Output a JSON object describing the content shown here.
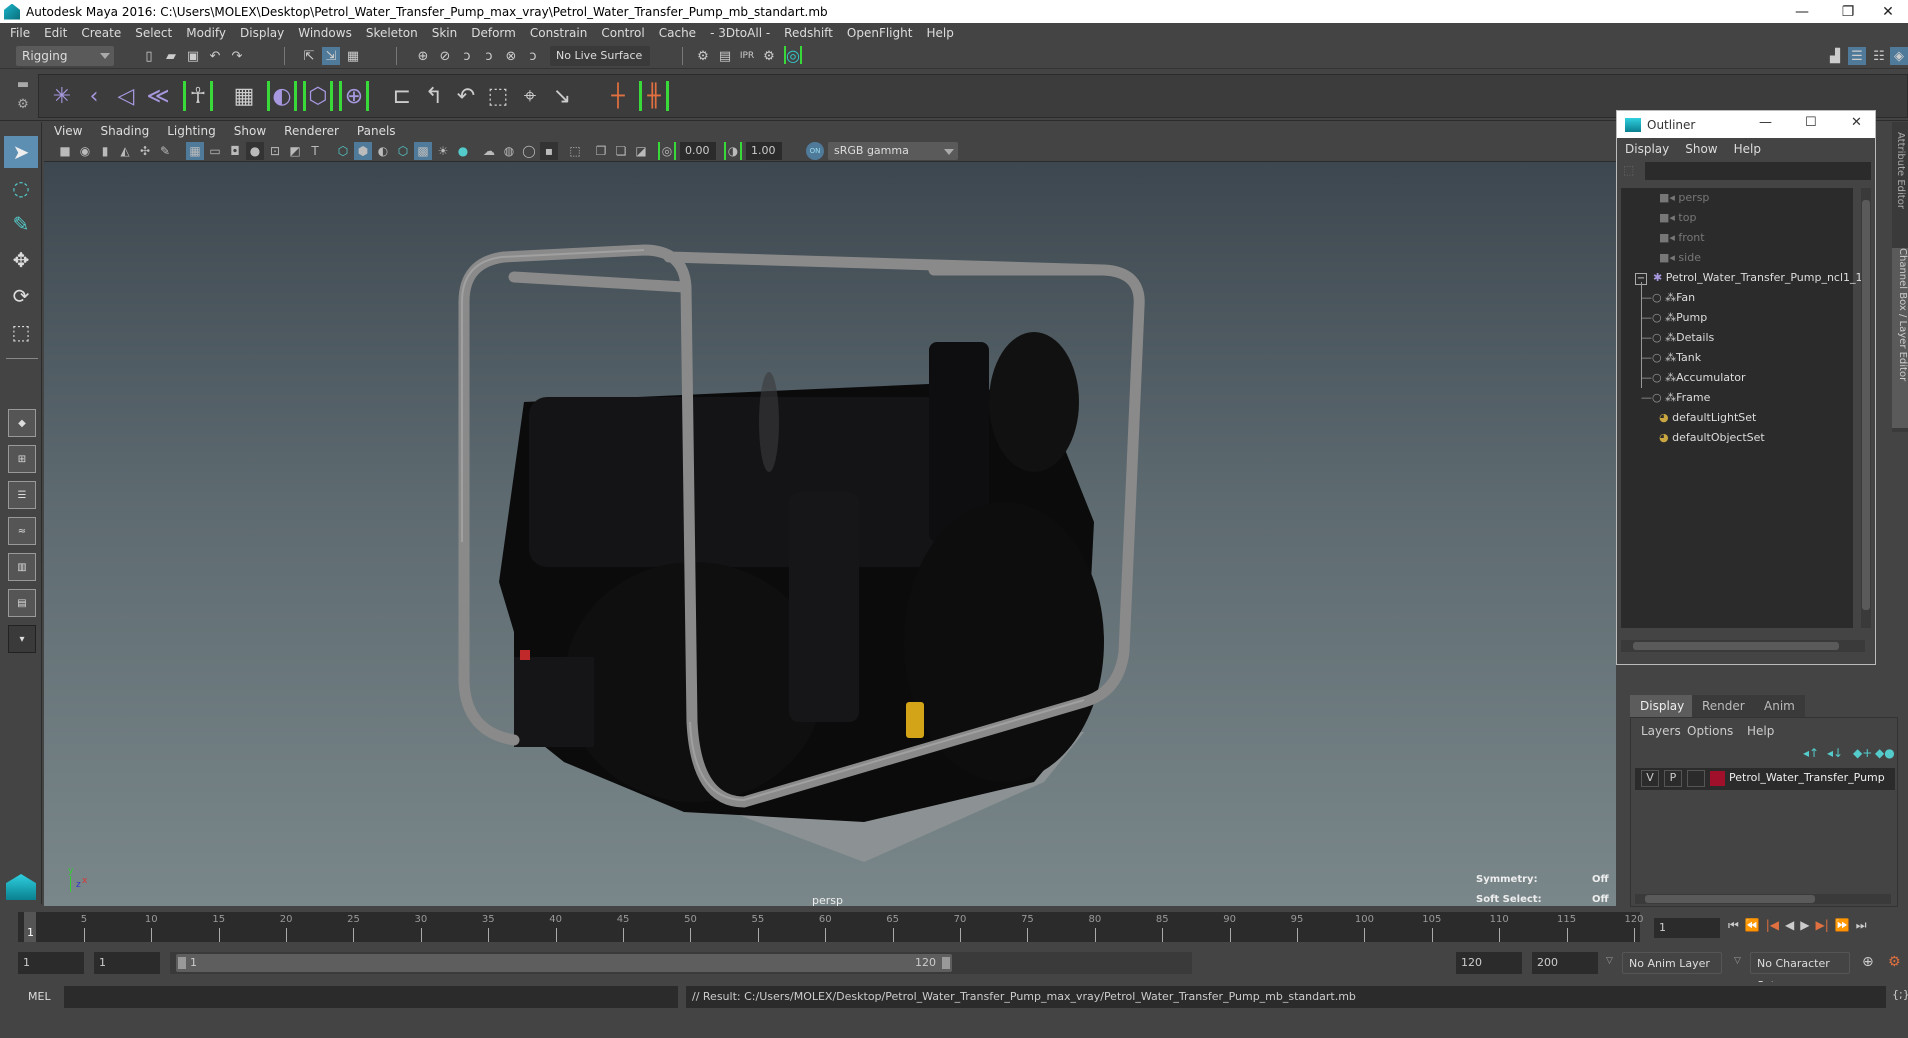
{
  "window": {
    "title": "Autodesk Maya 2016: C:\\Users\\MOLEX\\Desktop\\Petrol_Water_Transfer_Pump_max_vray\\Petrol_Water_Transfer_Pump_mb_standart.mb",
    "minimize": "—",
    "restore": "❐",
    "close": "✕"
  },
  "menubar": [
    "File",
    "Edit",
    "Create",
    "Select",
    "Modify",
    "Display",
    "Windows",
    "Skeleton",
    "Skin",
    "Deform",
    "Constrain",
    "Control",
    "Cache",
    "- 3DtoAll -",
    "Redshift",
    "OpenFlight",
    "Help"
  ],
  "statusline": {
    "menuset": "Rigging",
    "live_surface": "No Live Surface"
  },
  "panel": {
    "menus": [
      "View",
      "Shading",
      "Lighting",
      "Show",
      "Renderer",
      "Panels"
    ],
    "exposure": "0.00",
    "gamma": "1.00",
    "colorspace_toggle": "ON",
    "colorspace": "sRGB gamma"
  },
  "viewport": {
    "camera_label": "persp",
    "hud": [
      {
        "label": "Symmetry:",
        "value": "Off"
      },
      {
        "label": "Soft Select:",
        "value": "Off"
      }
    ],
    "axis": {
      "y": "y",
      "z": "z",
      "x": "x"
    }
  },
  "outliner": {
    "title": "Outliner",
    "menus": [
      "Display",
      "Show",
      "Help"
    ],
    "search_value": "",
    "items": [
      {
        "label": "persp",
        "type": "camera",
        "indent": 0
      },
      {
        "label": "top",
        "type": "camera",
        "indent": 0
      },
      {
        "label": "front",
        "type": "camera",
        "indent": 0
      },
      {
        "label": "side",
        "type": "camera",
        "indent": 0
      },
      {
        "label": "Petrol_Water_Transfer_Pump_ncl1_1",
        "type": "group",
        "indent": 0,
        "expanded": true
      },
      {
        "label": "Fan",
        "type": "mesh",
        "indent": 1
      },
      {
        "label": "Pump",
        "type": "mesh",
        "indent": 1
      },
      {
        "label": "Details",
        "type": "mesh",
        "indent": 1
      },
      {
        "label": "Tank",
        "type": "mesh",
        "indent": 1
      },
      {
        "label": "Accumulator",
        "type": "mesh",
        "indent": 1
      },
      {
        "label": "Frame",
        "type": "mesh",
        "indent": 1
      },
      {
        "label": "defaultLightSet",
        "type": "set",
        "indent": 0
      },
      {
        "label": "defaultObjectSet",
        "type": "set",
        "indent": 0
      }
    ]
  },
  "side_tabs": [
    "Attribute Editor",
    "Channel Box / Layer Editor"
  ],
  "layer_editor": {
    "tabs": [
      "Display",
      "Render",
      "Anim"
    ],
    "active_tab": "Display",
    "menus": [
      "Layers",
      "Options",
      "Help"
    ],
    "layers": [
      {
        "visible": "V",
        "playback": "P",
        "type": "",
        "color": "#a0102a",
        "name": "Petrol_Water_Transfer_Pump"
      }
    ]
  },
  "timeline": {
    "ticks": [
      "5",
      "10",
      "15",
      "20",
      "25",
      "30",
      "35",
      "40",
      "45",
      "50",
      "55",
      "60",
      "65",
      "70",
      "75",
      "80",
      "85",
      "90",
      "95",
      "100",
      "105",
      "110",
      "115",
      "120"
    ],
    "start_label": "1",
    "current_frame": "1",
    "playback": [
      "⏮",
      "⏪",
      "|◀",
      "◀",
      "▶",
      "▶|",
      "⏩",
      "⏭"
    ]
  },
  "range": {
    "start": "1",
    "playback_start": "1",
    "slider_start": "1",
    "slider_end": "120",
    "playback_end": "120",
    "end": "200",
    "anim_layer": "No Anim Layer",
    "character_set": "No Character Set"
  },
  "commandline": {
    "mode": "MEL",
    "input": "",
    "result": "// Result: C:/Users/MOLEX/Desktop/Petrol_Water_Transfer_Pump_max_vray/Petrol_Water_Transfer_Pump_mb_standart.mb"
  }
}
